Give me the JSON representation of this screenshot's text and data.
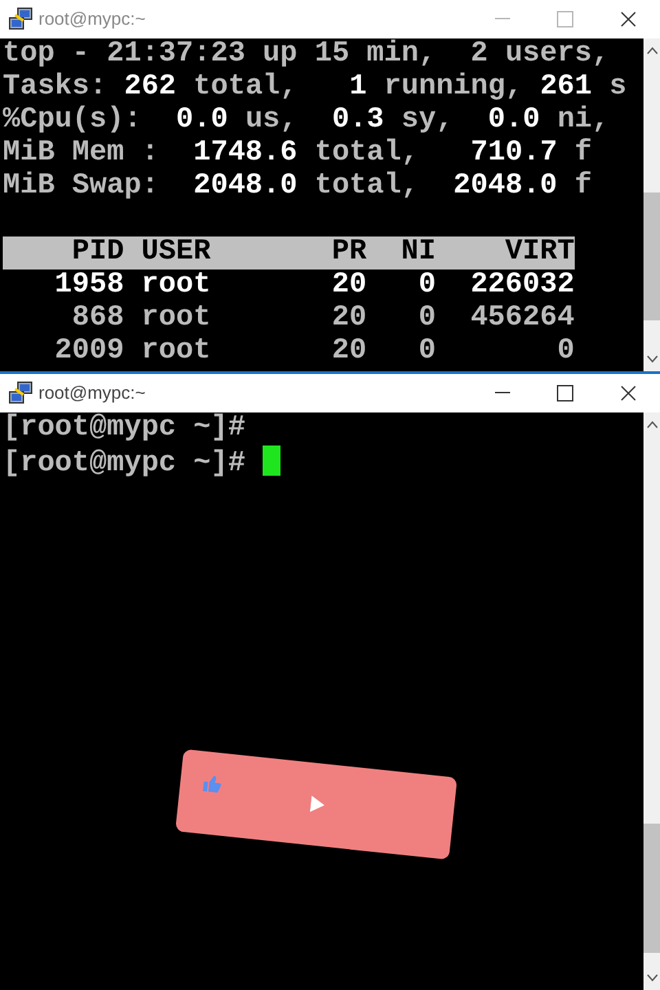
{
  "windows": [
    {
      "title": "root@mypc:~",
      "active": false,
      "lines": [
        "top - 21:37:23 up 15 min,  2 users,",
        "Tasks: **262** total,   **1** running, **261** s",
        "%Cpu(s):  **0.0** us,  **0.3** sy,  **0.0** ni,",
        "MiB Mem :  **1748.6** total,   **710.7** f",
        "MiB Swap:  **2048.0** total,  **2048.0** f"
      ],
      "table": {
        "columns": [
          "PID",
          "USER",
          "PR",
          "NI",
          "VIRT"
        ],
        "rows": [
          {
            "cells": [
              "1958",
              "root",
              "20",
              "0",
              "226032"
            ],
            "highlighted": true
          },
          {
            "cells": [
              "868",
              "root",
              "20",
              "0",
              "456264"
            ],
            "highlighted": false
          },
          {
            "cells": [
              "2009",
              "root",
              "20",
              "0",
              "0"
            ],
            "highlighted": false
          }
        ]
      }
    },
    {
      "title": "root@mypc:~",
      "active": true,
      "lines": [
        "[root@mypc ~]#",
        "[root@mypc ~]#"
      ],
      "cursor": true
    }
  ]
}
